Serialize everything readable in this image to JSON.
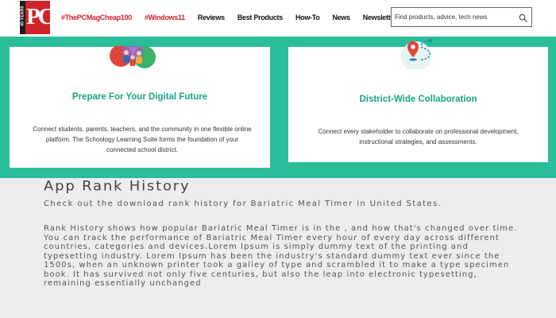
{
  "header": {
    "logo": {
      "text": "PC",
      "years": "40 YEARS"
    },
    "nav": [
      {
        "label": "#ThePCMagCheap100",
        "accent": true
      },
      {
        "label": "#Windows11",
        "accent": true
      },
      {
        "label": "Reviews",
        "accent": false
      },
      {
        "label": "Best Products",
        "accent": false
      },
      {
        "label": "How-To",
        "accent": false
      },
      {
        "label": "News",
        "accent": false
      },
      {
        "label": "Newsletters",
        "accent": false
      }
    ],
    "search": {
      "placeholder": "Find products, advice, tech news",
      "icon": "search-icon"
    }
  },
  "cards": [
    {
      "title": "Prepare For Your Digital Future",
      "description": "Connect students, parents, teachers, and the community in one flexible online platform. The Schoology Learning Suite forms the foundation of your connected school district.",
      "icon": "community-circles-icon"
    },
    {
      "title": "District-Wide Collaboration",
      "description": "Connect every stakeholder to collaborate on professional development, instructional strategies, and assessments.",
      "icon": "map-pin-route-icon"
    }
  ],
  "rank_history": {
    "title": "App Rank History",
    "intro": "Check out the download rank history for Bariatric Meal Timer in United States.",
    "body": "Rank History shows how popular Bariatric Meal Timer is in the , and how that's changed over time. You can track the performance of Bariatric Meal Timer every hour of every day across different countries, categories and devices.Lorem Ipsum is simply dummy text of the printing and typesetting industry. Lorem Ipsum has been the industry's standard dummy text ever since the 1500s, when an unknown printer took a galley of type and scrambled it to make a type specimen book. It has survived not only five centuries, but also the leap into electronic typesetting, remaining essentially unchanged"
  },
  "colors": {
    "brand_red": "#d1232a",
    "teal_band": "#2bbd9a",
    "card_title": "#1aa384",
    "page_background": "#ededed"
  }
}
